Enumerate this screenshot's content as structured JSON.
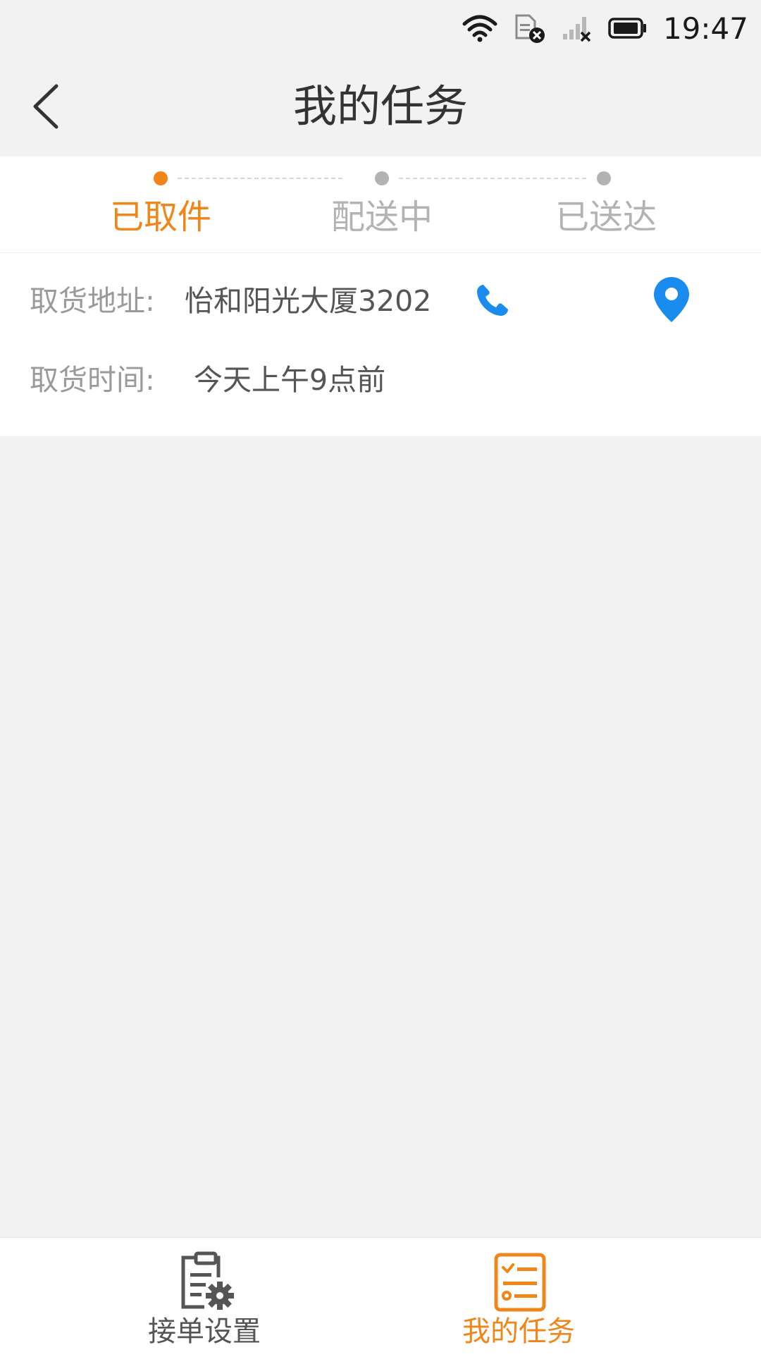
{
  "status_bar": {
    "time": "19:47"
  },
  "header": {
    "title": "我的任务"
  },
  "steps": [
    {
      "label": "已取件",
      "active": true
    },
    {
      "label": "配送中",
      "active": false
    },
    {
      "label": "已送达",
      "active": false
    }
  ],
  "task": {
    "pickup_address_label": "取货地址:",
    "pickup_address_value": "怡和阳光大厦3202",
    "pickup_time_label": "取货时间:",
    "pickup_time_value": "今天上午9点前"
  },
  "bottom_nav": [
    {
      "label": "接单设置",
      "icon": "clipboard-gear-icon",
      "active": false
    },
    {
      "label": "我的任务",
      "icon": "task-list-icon",
      "active": true
    }
  ],
  "colors": {
    "accent": "#f08519",
    "inactive": "#b3b3b3",
    "icon_blue": "#1a8cf0",
    "background": "#f2f2f2"
  }
}
